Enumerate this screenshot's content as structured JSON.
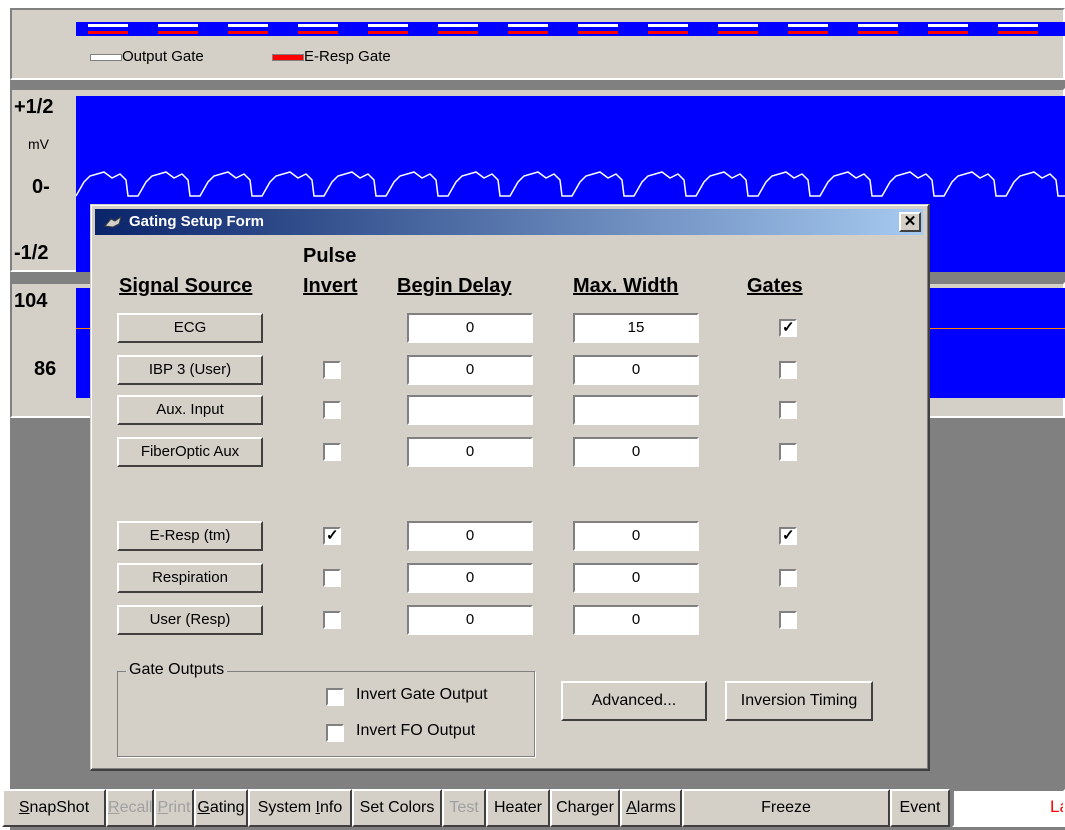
{
  "legend": {
    "output_gate": "Output Gate",
    "eresp_gate": "E-Resp Gate",
    "output_gate_color": "#ffffff",
    "eresp_gate_color": "#ff0000"
  },
  "ecg_panel": {
    "scale_top": "+1/2",
    "unit": "mV",
    "scale_zero": "0-",
    "scale_bottom": "-1/2",
    "trace_color": "#ffffff",
    "background_color": "#0000ff"
  },
  "second_panel": {
    "scale_top": "104",
    "scale_bottom": "86",
    "line_color": "#ff8000"
  },
  "dialog": {
    "title": "Gating Setup Form",
    "close": "✕",
    "headers": {
      "signal_source": "Signal Source",
      "pulse_invert_1": "Pulse",
      "pulse_invert_2": "Invert",
      "begin_delay": "Begin Delay",
      "max_width": "Max. Width",
      "gates": "Gates"
    },
    "rows": [
      {
        "source": "ECG",
        "invert": null,
        "begin_delay": "0",
        "max_width": "15",
        "gates": true
      },
      {
        "source": "IBP 3 (User)",
        "invert": false,
        "begin_delay": "0",
        "max_width": "0",
        "gates": false
      },
      {
        "source": "Aux. Input",
        "invert": false,
        "begin_delay": "",
        "max_width": "",
        "gates": false
      },
      {
        "source": "FiberOptic Aux",
        "invert": false,
        "begin_delay": "0",
        "max_width": "0",
        "gates": false
      },
      {
        "source": "E-Resp (tm)",
        "invert": true,
        "begin_delay": "0",
        "max_width": "0",
        "gates": true
      },
      {
        "source": "Respiration",
        "invert": false,
        "begin_delay": "0",
        "max_width": "0",
        "gates": false
      },
      {
        "source": "User (Resp)",
        "invert": false,
        "begin_delay": "0",
        "max_width": "0",
        "gates": false
      }
    ],
    "gate_outputs": {
      "label": "Gate Outputs",
      "invert_gate_output": "Invert Gate Output",
      "invert_fo_output": "Invert FO Output"
    },
    "advanced": "Advanced...",
    "inversion_timing": "Inversion Timing"
  },
  "bottom_bar": {
    "snapshot": "SnapShot",
    "recall": "Recall",
    "print": "Print",
    "gating": "Gating",
    "system_info": "System Info",
    "set_colors": "Set Colors",
    "test": "Test",
    "heater": "Heater",
    "charger": "Charger",
    "alarms": "Alarms",
    "freeze": "Freeze",
    "event": "Event",
    "status_text": "La",
    "status_color": "#ff0000"
  }
}
